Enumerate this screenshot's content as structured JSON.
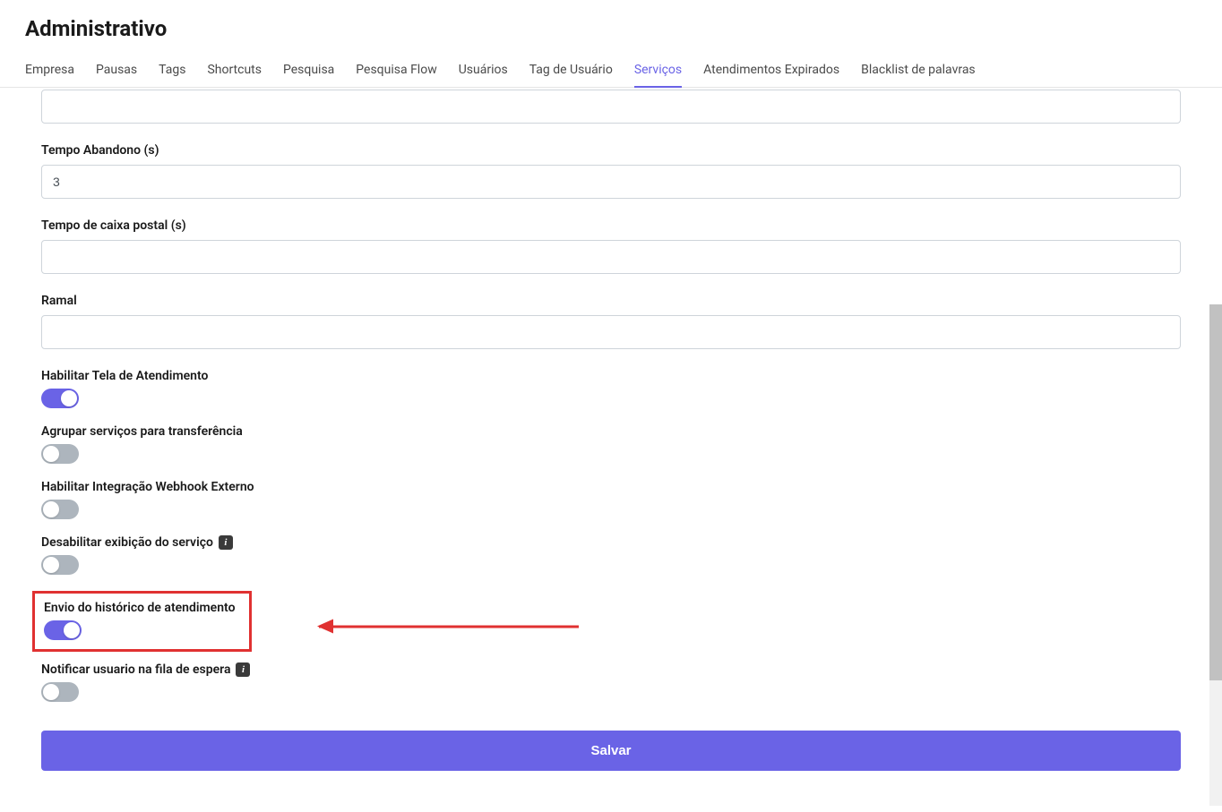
{
  "header": {
    "title": "Administrativo"
  },
  "tabs": [
    {
      "label": "Empresa",
      "active": false
    },
    {
      "label": "Pausas",
      "active": false
    },
    {
      "label": "Tags",
      "active": false
    },
    {
      "label": "Shortcuts",
      "active": false
    },
    {
      "label": "Pesquisa",
      "active": false
    },
    {
      "label": "Pesquisa Flow",
      "active": false
    },
    {
      "label": "Usuários",
      "active": false
    },
    {
      "label": "Tag de Usuário",
      "active": false
    },
    {
      "label": "Serviços",
      "active": true
    },
    {
      "label": "Atendimentos Expirados",
      "active": false
    },
    {
      "label": "Blacklist de palavras",
      "active": false
    }
  ],
  "form": {
    "field_cutoff": {
      "value": ""
    },
    "tempo_abandono": {
      "label": "Tempo Abandono (s)",
      "value": "3"
    },
    "tempo_caixa_postal": {
      "label": "Tempo de caixa postal (s)",
      "value": ""
    },
    "ramal": {
      "label": "Ramal",
      "value": ""
    },
    "toggles": {
      "habilitar_tela": {
        "label": "Habilitar Tela de Atendimento",
        "on": true
      },
      "agrupar_servicos": {
        "label": "Agrupar serviços para transferência",
        "on": false
      },
      "habilitar_webhook": {
        "label": "Habilitar Integração Webhook Externo",
        "on": false
      },
      "desabilitar_exibicao": {
        "label": "Desabilitar exibição do serviço",
        "on": false,
        "info": true
      },
      "envio_historico": {
        "label": "Envio do histórico de atendimento",
        "on": true
      },
      "notificar_usuario": {
        "label": "Notificar usuario na fila de espera",
        "on": false,
        "info": true
      }
    },
    "save_button": "Salvar"
  },
  "info_glyph": "i"
}
